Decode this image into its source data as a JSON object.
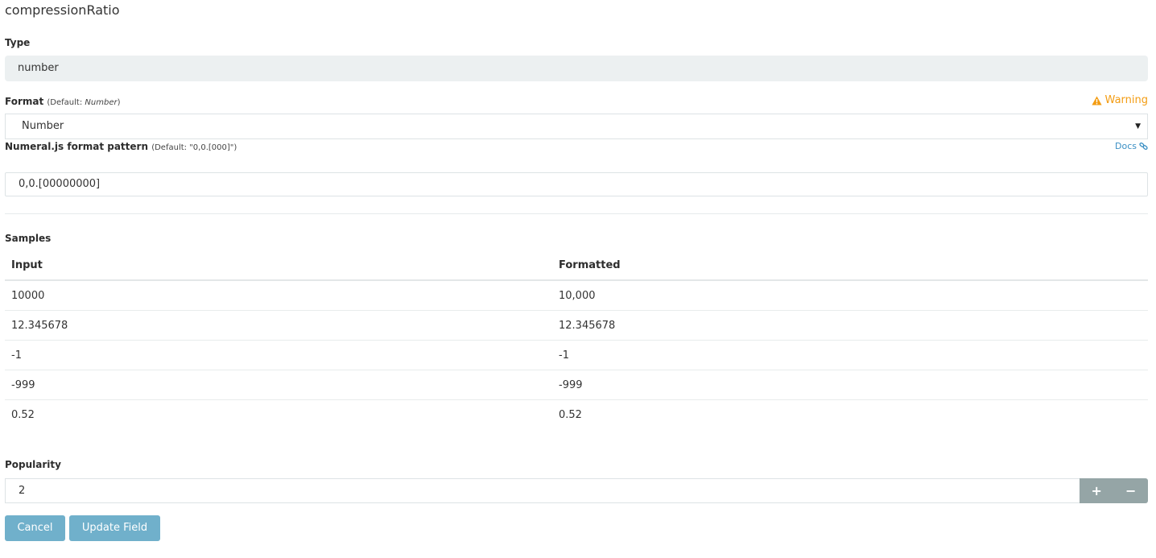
{
  "field": {
    "name": "compressionRatio"
  },
  "type_section": {
    "label": "Type",
    "value": "number"
  },
  "format_section": {
    "label": "Format",
    "default_prefix": "(Default: ",
    "default_value": "Number",
    "default_suffix": ")",
    "warning": "Warning",
    "selected": "Number"
  },
  "pattern_section": {
    "label": "Numeral.js format pattern",
    "default_hint": "(Default: \"0,0.[000]\")",
    "docs_link": "Docs",
    "value": "0,0.[00000000]"
  },
  "samples": {
    "label": "Samples",
    "columns": [
      "Input",
      "Formatted"
    ],
    "rows": [
      [
        "10000",
        "10,000"
      ],
      [
        "12.345678",
        "12.345678"
      ],
      [
        "-1",
        "-1"
      ],
      [
        "-999",
        "-999"
      ],
      [
        "0.52",
        "0.52"
      ]
    ]
  },
  "popularity": {
    "label": "Popularity",
    "value": "2",
    "increment": "+",
    "decrement": "−"
  },
  "actions": {
    "cancel": "Cancel",
    "update": "Update Field"
  },
  "colors": {
    "warning": "#f39c12",
    "link": "#3a8fc4",
    "button": "#70b0cb",
    "stepper": "#95a5a6",
    "readonly_bg": "#ecf0f1"
  },
  "icons": {
    "warning": "warning-triangle-icon",
    "docs": "link-icon",
    "select": "caret-down-icon"
  }
}
